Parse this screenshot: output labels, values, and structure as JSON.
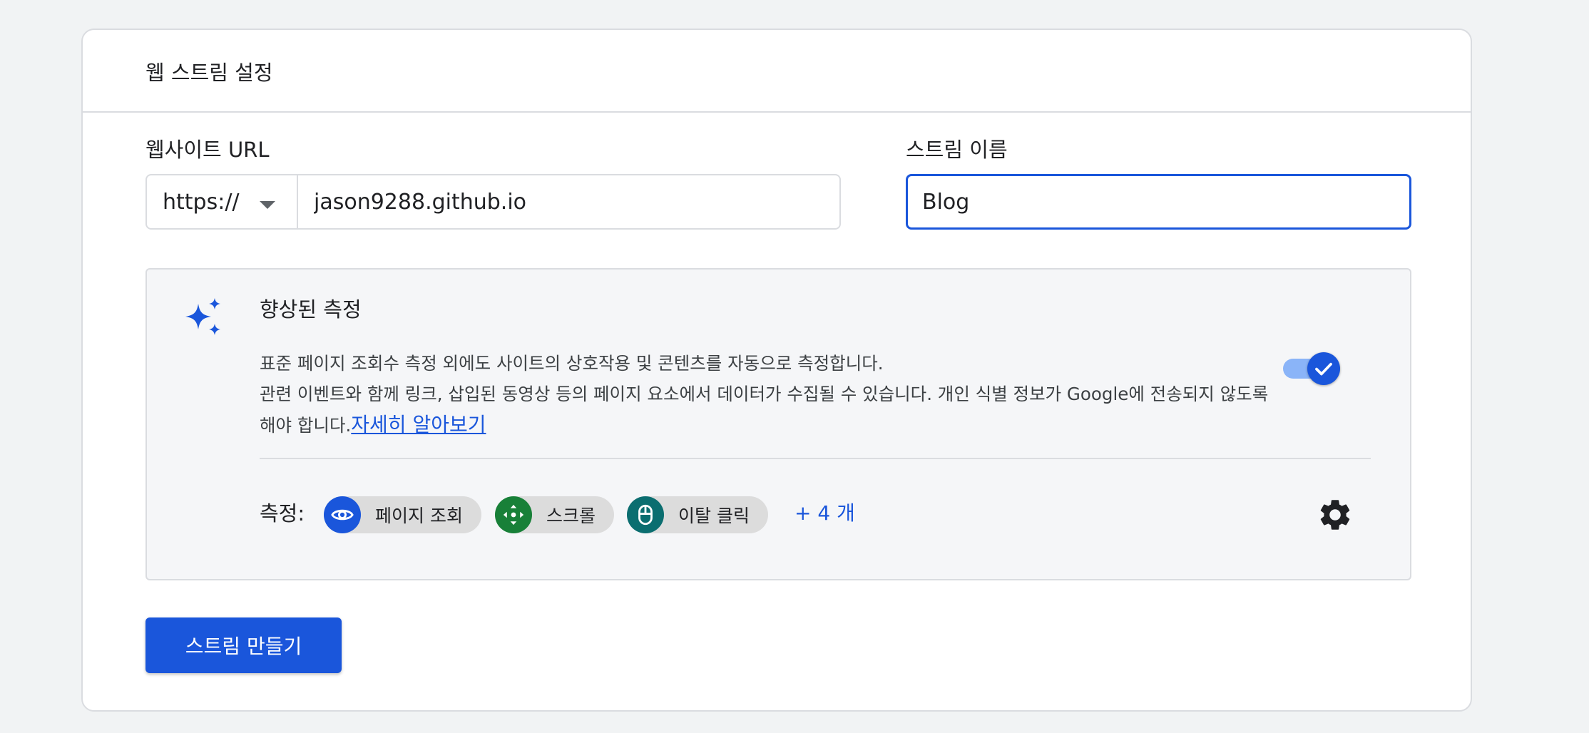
{
  "card": {
    "title": "웹 스트림 설정"
  },
  "website_url": {
    "label": "웹사이트 URL",
    "protocol": "https://",
    "value": "jason9288.github.io"
  },
  "stream_name": {
    "label": "스트림 이름",
    "value": "Blog"
  },
  "enhanced_measurement": {
    "title": "향상된 측정",
    "line1": "표준 페이지 조회수 측정 외에도 사이트의 상호작용 및 콘텐츠를 자동으로 측정합니다.",
    "line2": "관련 이벤트와 함께 링크, 삽입된 동영상 등의 페이지 요소에서 데이터가 수집될 수 있습니다. 개인 식별 정보가 Google에 전송되지 않도록 해야 합니다.",
    "learn_more": "자세히 알아보기",
    "toggle_on": true,
    "measure_label": "측정:",
    "chips": [
      {
        "label": "페이지 조회",
        "icon": "eye-icon",
        "color": "#1a56db"
      },
      {
        "label": "스크롤",
        "icon": "scroll-arrows-icon",
        "color": "#188038"
      },
      {
        "label": "이탈 클릭",
        "icon": "mouse-icon",
        "color": "#0b6e70"
      }
    ],
    "more": "+ 4 개"
  },
  "actions": {
    "create_label": "스트림 만들기"
  },
  "colors": {
    "accent": "#1a56db",
    "toggle_track": "#8ab4f8"
  }
}
